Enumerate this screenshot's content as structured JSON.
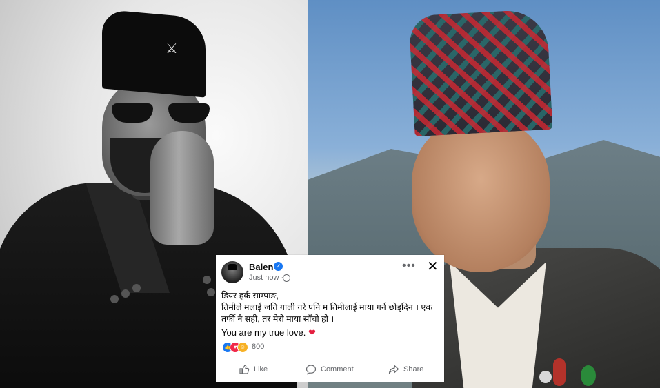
{
  "post": {
    "author": "Balen",
    "time": "Just now ·",
    "line1": "डियर हर्क साम्पाङ,",
    "line2": "तिमीले मलाई जति गाली गरे पनि म तिमीलाई माया गर्न छोड्दिन । एक तर्फी नै सही, तर मेरो माया साँचो हो ।",
    "english": "You are my true love.",
    "reaction_count": "800",
    "actions": {
      "like": "Like",
      "comment": "Comment",
      "share": "Share"
    },
    "icons": [
      "verified-icon",
      "globe-icon",
      "more-icon",
      "close-icon",
      "heart-icon",
      "like-icon",
      "comment-icon",
      "share-icon"
    ],
    "colors": {
      "accent": "#1877f2",
      "heart": "#e41e3f",
      "secondary_text": "#65676b"
    }
  }
}
